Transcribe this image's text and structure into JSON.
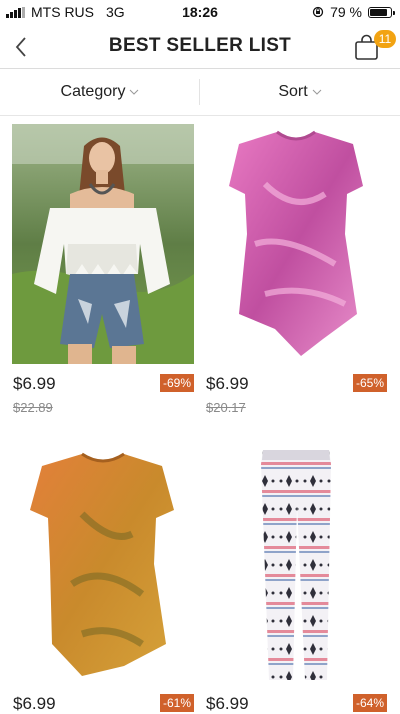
{
  "status": {
    "carrier": "MTS RUS",
    "network": "3G",
    "time": "18:26",
    "battery": "79 %",
    "battery_level": 0.79
  },
  "nav": {
    "title": "BEST SELLER LIST",
    "cart_count": "11"
  },
  "filters": {
    "category": "Category",
    "sort": "Sort"
  },
  "products": [
    {
      "price": "$6.99",
      "old_price": "$22.89",
      "discount": "-69%"
    },
    {
      "price": "$6.99",
      "old_price": "$20.17",
      "discount": "-65%"
    },
    {
      "price": "$6.99",
      "discount": "-61%"
    },
    {
      "price": "$6.99",
      "discount": "-64%"
    }
  ],
  "colors": {
    "accent_badge": "#f2a312",
    "discount_bg": "#d0612b"
  }
}
